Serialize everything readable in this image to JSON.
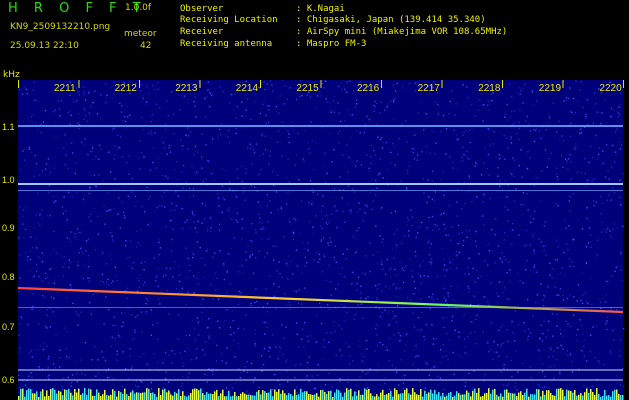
{
  "header": {
    "title": "H R O F F T",
    "version": "1.0.0f",
    "filename": "KN9_2509132210.png",
    "meteor_label": "meteor",
    "datetime": "25.09.13 22:10",
    "meteor_count": "42"
  },
  "info": {
    "rows": [
      {
        "label": "Observer",
        "value": ": K.Nagai"
      },
      {
        "label": "Receiving Location",
        "value": ": Chigasaki, Japan (139.414 35.340)"
      },
      {
        "label": "Receiver",
        "value": ": AirSpy mini (Miakejima VOR 108.65MHz)"
      },
      {
        "label": "Receiving antenna",
        "value": ": Maspro FM-3"
      }
    ]
  },
  "spectrogram": {
    "unit_label": "kHz",
    "time_labels": [
      "2211",
      "2212",
      "2213",
      "2214",
      "2215",
      "2216",
      "2217",
      "2218",
      "2219",
      "2220"
    ],
    "freq_labels": [
      "1.1",
      "1.0",
      "0.9",
      "0.8",
      "0.7",
      "0.6"
    ],
    "colors": {
      "background": "#00007a",
      "label": "#e8e800",
      "line": "#7fb4ff",
      "signal": "#ff4040"
    }
  }
}
